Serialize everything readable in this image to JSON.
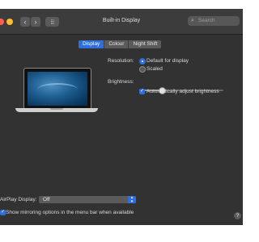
{
  "window": {
    "title": "Built-in Display",
    "search_placeholder": "Search",
    "grid_icon": "grid-icon"
  },
  "tabs": [
    {
      "label": "Display",
      "active": true
    },
    {
      "label": "Colour",
      "active": false
    },
    {
      "label": "Night Shift",
      "active": false
    }
  ],
  "resolution": {
    "label": "Resolution:",
    "options": [
      {
        "label": "Default for display",
        "selected": true
      },
      {
        "label": "Scaled",
        "selected": false
      }
    ]
  },
  "brightness": {
    "label": "Brightness:",
    "level": 0.27,
    "auto_adjust_label": "Automatically adjust brightness",
    "auto_adjust_checked": true
  },
  "airplay": {
    "label": "AirPlay Display:",
    "value": "Off"
  },
  "mirroring": {
    "label": "Show mirroring options in the menu bar when available",
    "checked": true
  },
  "help": {
    "label": "?"
  },
  "colors": {
    "accent": "#2f6fdb",
    "window_bg": "#323232",
    "close": "#ff5f57",
    "minimize": "#febc2e",
    "zoom": "#28c840"
  }
}
